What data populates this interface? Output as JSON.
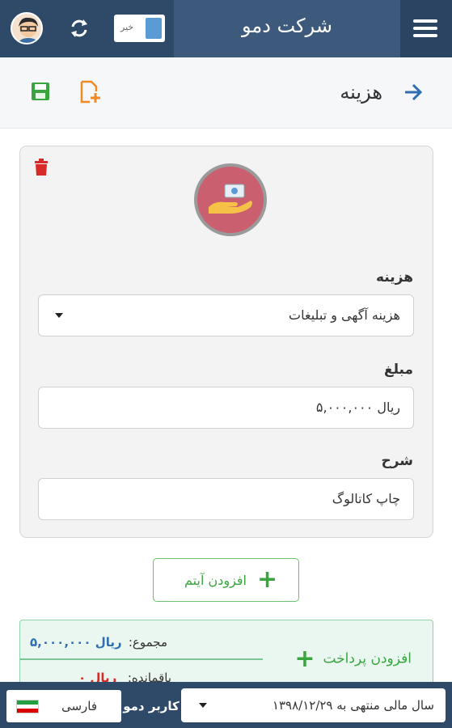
{
  "header": {
    "app_title": "شرکت دمو",
    "toggle_label": "خیر"
  },
  "subheader": {
    "page_title": "هزینه"
  },
  "form": {
    "expense_label": "هزینه",
    "expense_value": "هزینه آگهی و تبلیغات",
    "amount_label": "مبلغ",
    "amount_value": "ریال ۵,۰۰۰,۰۰۰",
    "description_label": "شرح",
    "description_value": "چاپ کاتالوگ"
  },
  "actions": {
    "add_item_label": "افزودن آیتم",
    "add_payment_label": "افزودن پرداخت"
  },
  "summary": {
    "total_label": "مجموع:",
    "total_value": "ریال ۵,۰۰۰,۰۰۰",
    "remaining_label": "باقمانده:",
    "remaining_value": "ریال ۰"
  },
  "footer": {
    "fiscal_year": "سال مالی منتهی به ۱۳۹۸/۱۲/۲۹",
    "user_name": "کاربر دمو",
    "language": "فارسی"
  },
  "colors": {
    "topbar": "#2f4a68",
    "accent_green": "#3aa53f",
    "delete_red": "#d92a2a",
    "link_blue": "#2f6fb0"
  },
  "icons": [
    "hamburger-menu-icon",
    "sync-icon",
    "avatar",
    "arrow-right-icon",
    "new-document-icon",
    "save-icon",
    "trash-icon",
    "expense-payment-icon",
    "plus-icon",
    "iran-flag-icon"
  ]
}
